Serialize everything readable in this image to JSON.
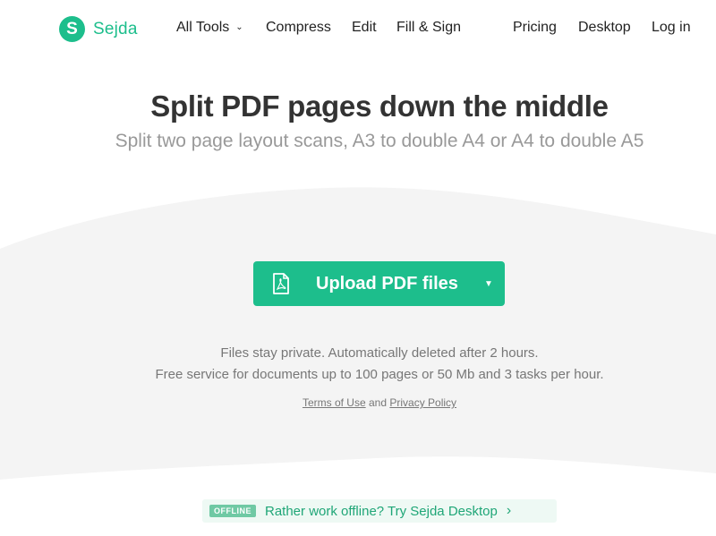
{
  "brand": {
    "name": "Sejda",
    "mark": "S",
    "color": "#1dbe8c"
  },
  "nav": {
    "all_tools": "All Tools",
    "compress": "Compress",
    "edit": "Edit",
    "fill_sign": "Fill & Sign",
    "pricing": "Pricing",
    "desktop": "Desktop",
    "login": "Log in"
  },
  "hero": {
    "title": "Split PDF pages down the middle",
    "subtitle": "Split two page layout scans, A3 to double A4 or A4 to double A5"
  },
  "upload": {
    "label": "Upload PDF files",
    "icon": "pdf-file-icon",
    "dropdown_icon": "caret-down-icon"
  },
  "info": {
    "line1": "Files stay private. Automatically deleted after 2 hours.",
    "line2": "Free service for documents up to 100 pages or 50 Mb and 3 tasks per hour."
  },
  "legal": {
    "terms": "Terms of Use",
    "and": "and",
    "privacy": "Privacy Policy"
  },
  "offline": {
    "badge": "OFFLINE",
    "text": "Rather work offline? Try Sejda Desktop"
  },
  "colors": {
    "accent": "#1dbe8c",
    "wave": "#f4f4f4"
  }
}
